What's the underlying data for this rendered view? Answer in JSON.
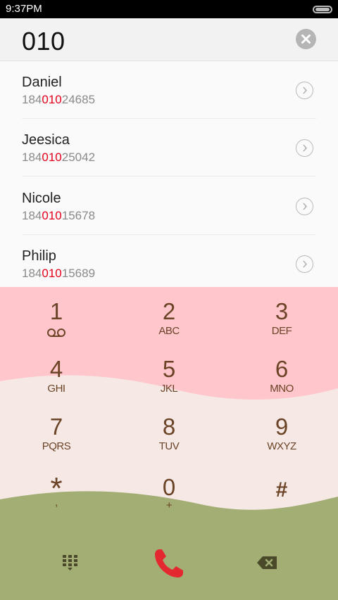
{
  "status": {
    "time": "9:37PM"
  },
  "search": {
    "query": "010"
  },
  "contacts": [
    {
      "name": "Daniel",
      "number_before": "184",
      "number_match": "010",
      "number_after": "24685"
    },
    {
      "name": "Jeesica",
      "number_before": "184",
      "number_match": "010",
      "number_after": "25042"
    },
    {
      "name": "Nicole",
      "number_before": "184",
      "number_match": "010",
      "number_after": "15678"
    },
    {
      "name": "Philip",
      "number_before": "184",
      "number_match": "010",
      "number_after": "15689"
    }
  ],
  "keys": [
    {
      "digit": "1",
      "letters": ""
    },
    {
      "digit": "2",
      "letters": "ABC"
    },
    {
      "digit": "3",
      "letters": "DEF"
    },
    {
      "digit": "4",
      "letters": "GHI"
    },
    {
      "digit": "5",
      "letters": "JKL"
    },
    {
      "digit": "6",
      "letters": "MNO"
    },
    {
      "digit": "7",
      "letters": "PQRS"
    },
    {
      "digit": "8",
      "letters": "TUV"
    },
    {
      "digit": "9",
      "letters": "WXYZ"
    },
    {
      "digit": "*",
      "letters": ","
    },
    {
      "digit": "0",
      "letters": "+"
    },
    {
      "digit": "#",
      "letters": ""
    }
  ],
  "icons": {
    "voicemail": "voicemail-icon",
    "clear": "clear-icon",
    "detail": "chevron-right-icon",
    "dialpad": "dialpad-icon",
    "call": "phone-icon",
    "backspace": "backspace-icon"
  },
  "colors": {
    "highlight": "#e3001b",
    "keypad_top": "#ffc6cc",
    "keypad_middle": "#f5e8e5",
    "keypad_bottom": "#a2ae74",
    "key_text": "#6b4326",
    "call": "#e3282f"
  }
}
